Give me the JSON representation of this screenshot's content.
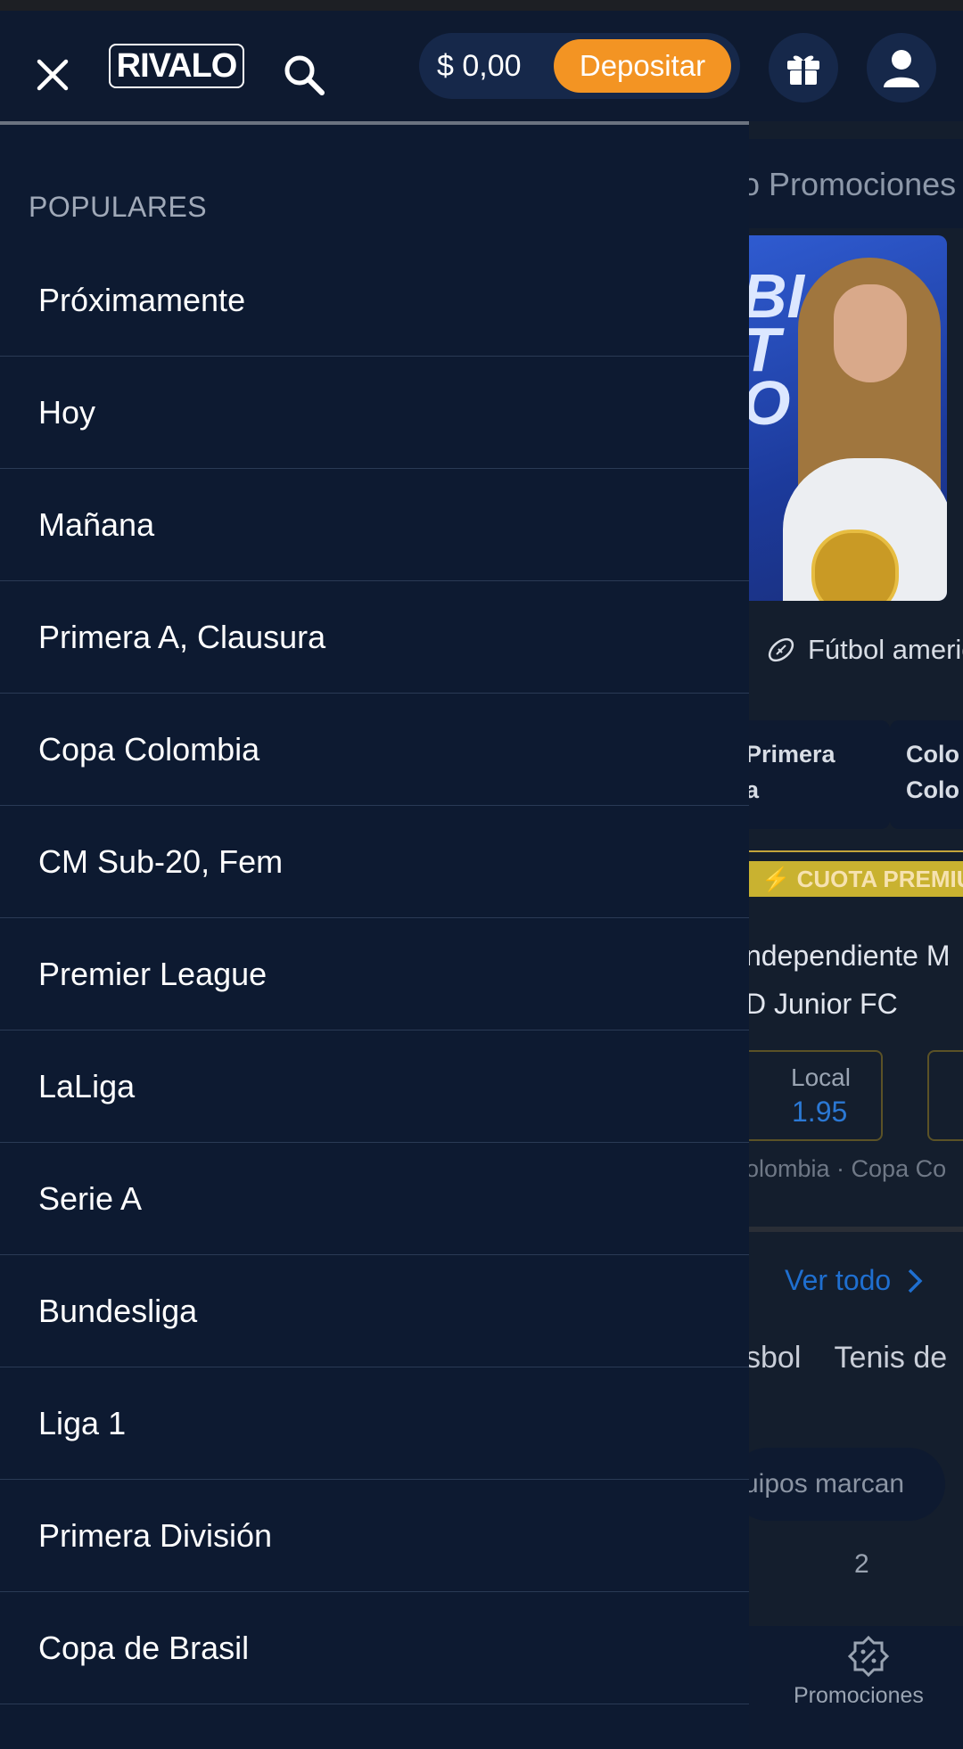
{
  "header": {
    "logo_text": "RIVALO",
    "balance": "$ 0,00",
    "deposit_label": "Depositar"
  },
  "drawer": {
    "section_title": "POPULARES",
    "items": [
      "Próximamente",
      "Hoy",
      "Mañana",
      "Primera A, Clausura",
      "Copa Colombia",
      "CM Sub-20, Fem",
      "Premier League",
      "LaLiga",
      "Serie A",
      "Bundesliga",
      "Liga 1",
      "Primera División",
      "Copa de Brasil"
    ]
  },
  "background": {
    "nav_partial": "o   Promociones",
    "banner_text": "BI\nT\nO",
    "sport_chip": "Fútbol americano",
    "card_1": "Primera\na",
    "card_2": "Colo\nColo",
    "badge": "CUOTA PREMIUM",
    "match_home": "ndependiente M",
    "match_away": "D Junior FC",
    "odd_label": "Local",
    "odd_value": "1.95",
    "league": "olombia · Copa Co",
    "view_all": "Ver todo",
    "tabs": "sbol    Tenis de",
    "filter": "uipos marcan",
    "col_2": "2",
    "bottom_promo": "Promociones"
  },
  "colors": {
    "header_bg": "#0e1a30",
    "drawer_bg": "#0d1a31",
    "accent_orange": "#f39423",
    "link_blue": "#1f6fd0",
    "premium_gold": "#c9b230"
  }
}
